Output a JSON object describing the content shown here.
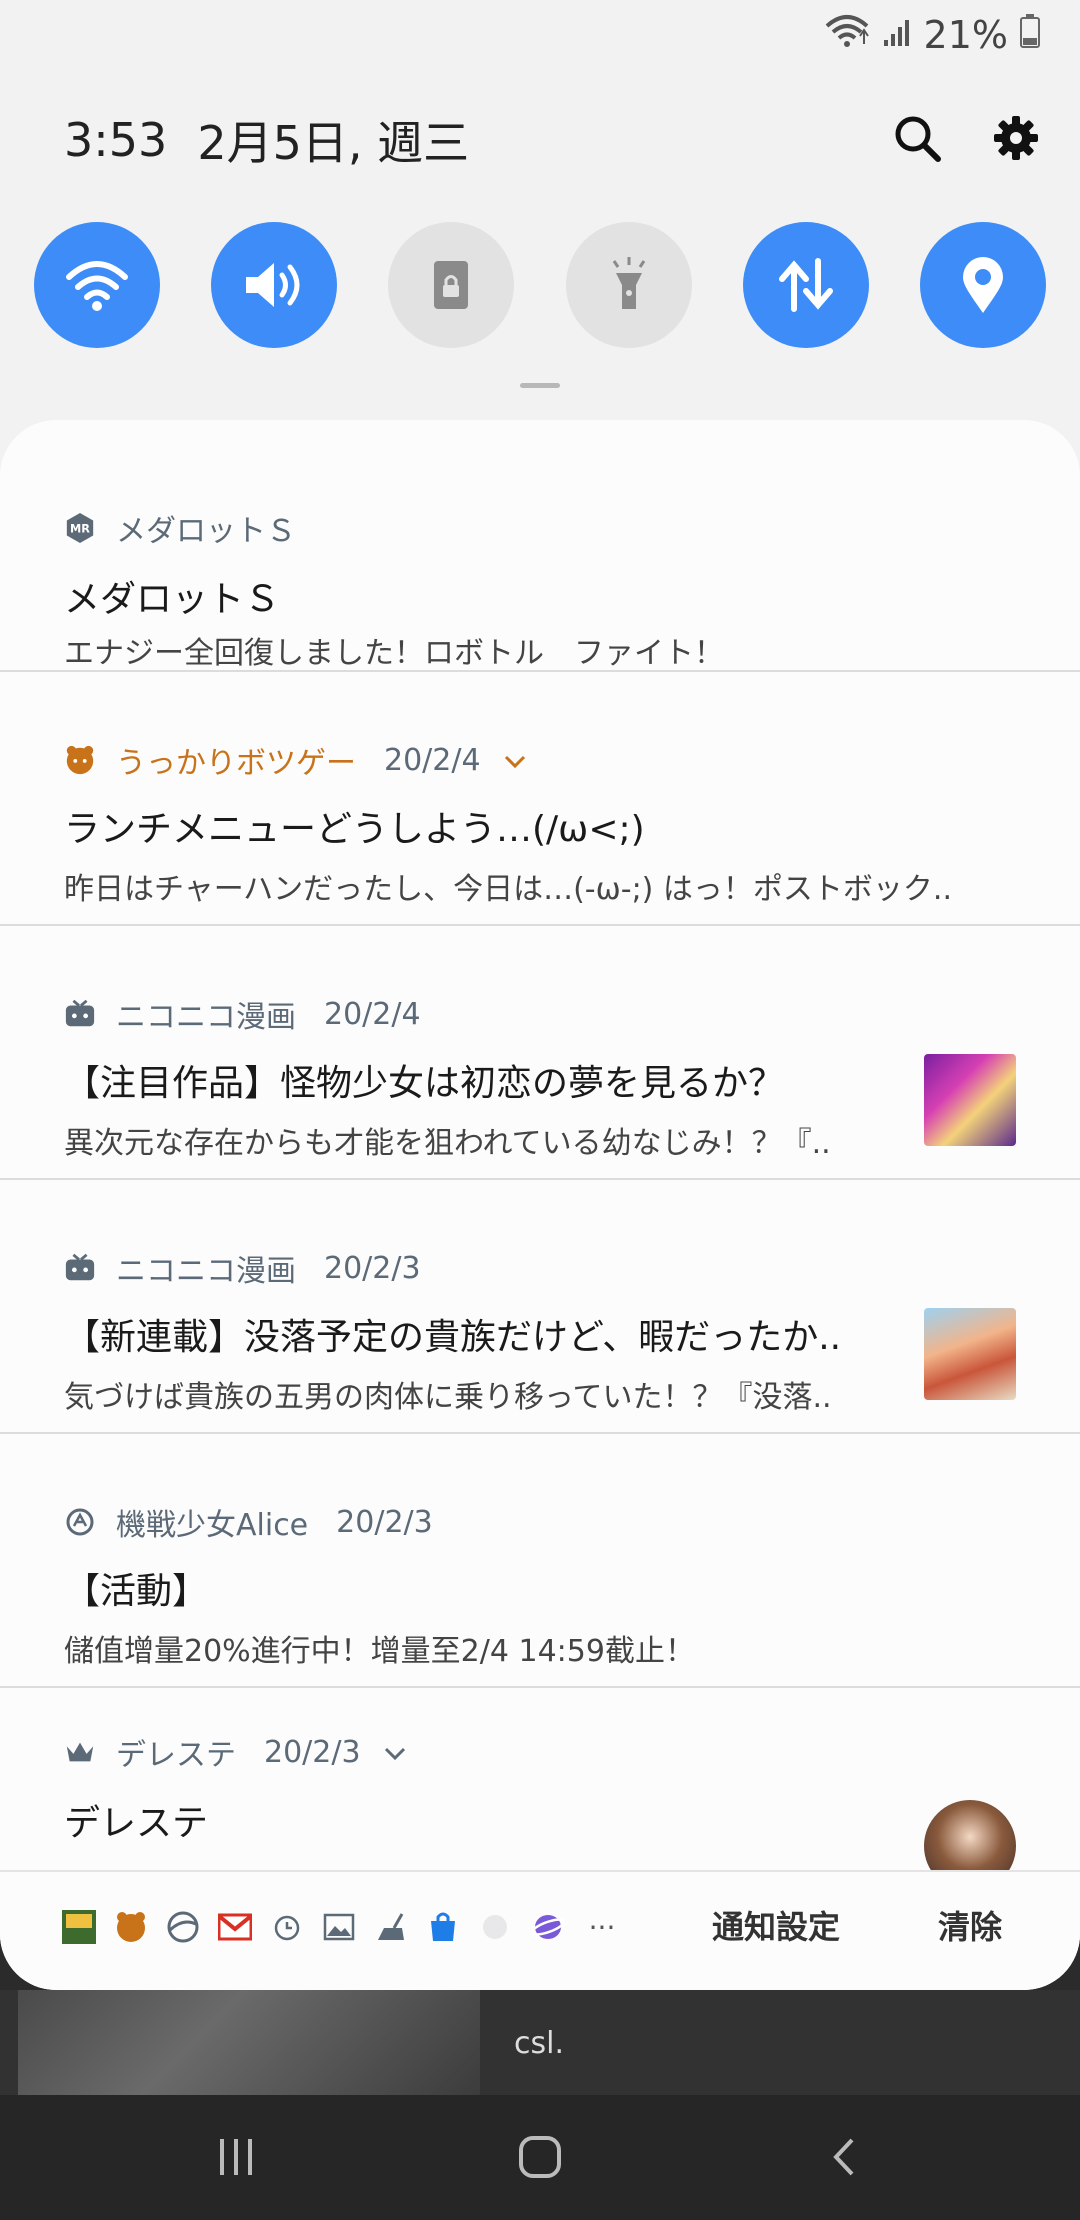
{
  "status": {
    "battery": "21%"
  },
  "header": {
    "time": "3:53",
    "date": "2月5日, 週三"
  },
  "quick_settings": [
    {
      "name": "wifi",
      "state": "on"
    },
    {
      "name": "sound",
      "state": "on"
    },
    {
      "name": "rotation-lock",
      "state": "off"
    },
    {
      "name": "flashlight",
      "state": "off"
    },
    {
      "name": "mobile-data",
      "state": "on"
    },
    {
      "name": "location",
      "state": "on"
    }
  ],
  "notifications": [
    {
      "app": "メダロットＳ",
      "time": "",
      "title": "メダロットＳ",
      "text": "エナジー全回復しました！ロボトル　ファイト！"
    },
    {
      "app": "うっかりボツゲー",
      "time": "20/2/4",
      "title": "ランチメニューどうしよう…(/ω<;)",
      "text": "昨日はチャーハンだったし、今日は…(-ω-;) はっ！ポストボック.."
    },
    {
      "app": "ニコニコ漫画",
      "time": "20/2/4",
      "title": "【注目作品】怪物少女は初恋の夢を見るか？",
      "text": "異次元な存在からも才能を狙われている幼なじみ！？『.."
    },
    {
      "app": "ニコニコ漫画",
      "time": "20/2/3",
      "title": "【新連載】没落予定の貴族だけど、暇だったか..",
      "text": "気づけば貴族の五男の肉体に乗り移っていた！？『没落.."
    },
    {
      "app": "機戦少女Alice",
      "time": "20/2/3",
      "title": "【活動】",
      "text": "儲值增量20%進行中！增量至2/4 14:59截止！"
    },
    {
      "app": "デレステ",
      "time": "20/2/3",
      "title": "デレステ",
      "text": ""
    }
  ],
  "bottom": {
    "more": "···",
    "settings_label": "通知設定",
    "clear_label": "清除"
  },
  "behind": {
    "text": "csl."
  },
  "colors": {
    "accent": "#3e8cf7",
    "app_orange": "#c8731a",
    "app_gray": "#5c6a78"
  }
}
